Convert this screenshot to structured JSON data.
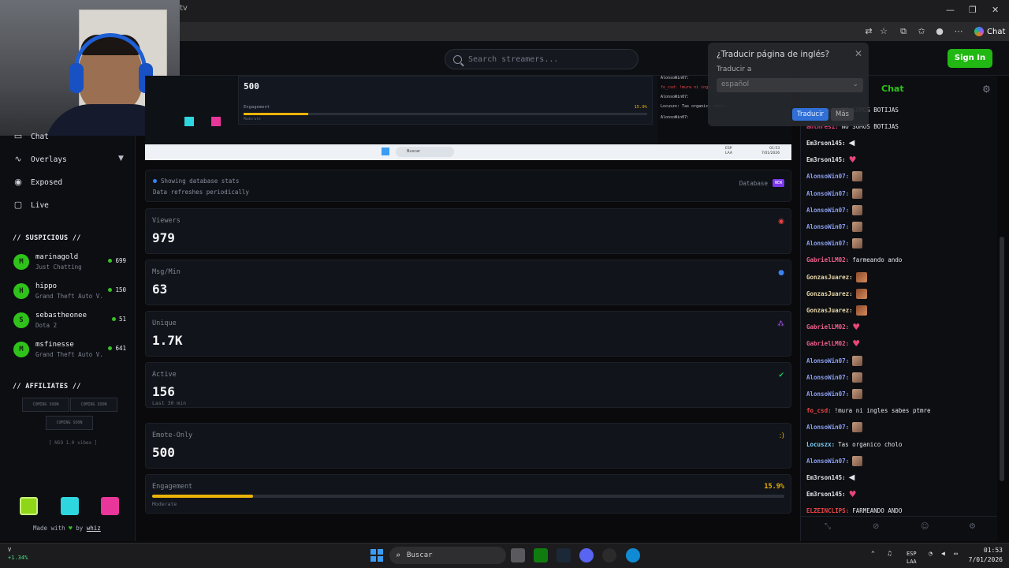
{
  "browser": {
    "address_fragment": "tv",
    "chat_button": "Chat",
    "window_controls": [
      "—",
      "❐",
      "✕"
    ]
  },
  "header": {
    "search_placeholder": "Search streamers...",
    "signin_label": "Sign In"
  },
  "translate_popup": {
    "title": "¿Traducir página de inglés?",
    "translate_to_label": "Traducir a",
    "language_value": "español",
    "translate_button": "Traducir",
    "more_button": "Más"
  },
  "sidebar": {
    "nav": [
      {
        "label": "Chat",
        "icon": "chat-icon"
      },
      {
        "label": "Overlays",
        "icon": "activity-icon"
      },
      {
        "label": "Exposed",
        "icon": "eye-icon"
      },
      {
        "label": "Live",
        "icon": "tv-icon"
      }
    ],
    "suspicious_header": "// SUSPICIOUS //",
    "suspicious": [
      {
        "initial": "M",
        "name": "marinagold",
        "game": "Just Chatting",
        "count": "699"
      },
      {
        "initial": "H",
        "name": "hippo",
        "game": "Grand Theft Auto V...",
        "count": "150"
      },
      {
        "initial": "S",
        "name": "sebastheonee",
        "game": "Dota 2",
        "count": "51"
      },
      {
        "initial": "M",
        "name": "msfinesse",
        "game": "Grand Theft Auto V...",
        "count": "641"
      }
    ],
    "affiliates_header": "// AFFILIATES //",
    "affiliates": [
      "COMING SOON",
      "COMING SOON",
      "COMING SOON"
    ],
    "affiliates_sub": "[ NSO 1.0 vibes ]",
    "swatch_colors": [
      "#8fd619",
      "#2ed6e0",
      "#e8369a"
    ],
    "made_with": "Made with",
    "by": "by",
    "author": "whiz"
  },
  "mini": {
    "stat_value": "500",
    "engagement_label": "Engagement",
    "engagement_pct": "15.9%",
    "engagement_sub": "Moderate",
    "chat_lines": [
      "AlonsoWin07:",
      "fo_csd: !mura ni ingles sabes ptmre",
      "AlonsoWin07:",
      "Locuszx: Tas organico cholo",
      "AlonsoWin07:"
    ]
  },
  "info": {
    "line1": "Showing database stats",
    "line2": "Data refreshes periodically",
    "database_label": "Database",
    "new_badge": "NEW"
  },
  "stats": [
    {
      "label": "Viewers",
      "value": "979",
      "sub": "",
      "icon": "eye-icon",
      "color": "#ef4444"
    },
    {
      "label": "Msg/Min",
      "value": "63",
      "sub": "",
      "icon": "message-icon",
      "color": "#3b82f6"
    },
    {
      "label": "Unique",
      "value": "1.7K",
      "sub": "",
      "icon": "users-icon",
      "color": "#a855f7"
    },
    {
      "label": "Active",
      "value": "156",
      "sub": "Last 30 min",
      "icon": "check-circle-icon",
      "color": "#22c55e"
    },
    {
      "label": "Emote-Only",
      "value": "500",
      "sub": "",
      "icon": "smile-icon",
      "color": "#eab308"
    }
  ],
  "engagement": {
    "label": "Engagement",
    "pct_text": "15.9%",
    "fraction": 0.159,
    "sub": "Moderate"
  },
  "chat": {
    "title": "Chat",
    "messages": [
      {
        "user": "anthres1:",
        "color": "#e8467a",
        "text": "NO SOMOS BOTIJAS",
        "emote": ""
      },
      {
        "user": "anthres1:",
        "color": "#e8467a",
        "text": "NO SOMOS BOTIJAS",
        "emote": ""
      },
      {
        "user": "Em3rson145:",
        "color": "#e4e7ec",
        "text": "",
        "emote": "spk"
      },
      {
        "user": "Em3rson145:",
        "color": "#e4e7ec",
        "text": "",
        "emote": "heart"
      },
      {
        "user": "AlonsoWin07:",
        "color": "#8da0f0",
        "text": "",
        "emote": "face"
      },
      {
        "user": "AlonsoWin07:",
        "color": "#8da0f0",
        "text": "",
        "emote": "face"
      },
      {
        "user": "AlonsoWin07:",
        "color": "#8da0f0",
        "text": "",
        "emote": "face"
      },
      {
        "user": "AlonsoWin07:",
        "color": "#8da0f0",
        "text": "",
        "emote": "face"
      },
      {
        "user": "AlonsoWin07:",
        "color": "#8da0f0",
        "text": "",
        "emote": "face"
      },
      {
        "user": "GabrielLM02:",
        "color": "#f0608c",
        "text": "farmeando ando",
        "emote": ""
      },
      {
        "user": "GonzasJuarez:",
        "color": "#e8d7a8",
        "text": "",
        "emote": "crowd"
      },
      {
        "user": "GonzasJuarez:",
        "color": "#e8d7a8",
        "text": "",
        "emote": "crowd"
      },
      {
        "user": "GonzasJuarez:",
        "color": "#e8d7a8",
        "text": "",
        "emote": "crowd"
      },
      {
        "user": "GabrielLM02:",
        "color": "#f0608c",
        "text": "",
        "emote": "heart"
      },
      {
        "user": "GabrielLM02:",
        "color": "#f0608c",
        "text": "",
        "emote": "heart"
      },
      {
        "user": "AlonsoWin07:",
        "color": "#8da0f0",
        "text": "",
        "emote": "face"
      },
      {
        "user": "AlonsoWin07:",
        "color": "#8da0f0",
        "text": "",
        "emote": "face"
      },
      {
        "user": "AlonsoWin07:",
        "color": "#8da0f0",
        "text": "",
        "emote": "face"
      },
      {
        "user": "fo_csd:",
        "color": "#ef4444",
        "text": "!mura ni ingles sabes ptmre",
        "emote": ""
      },
      {
        "user": "AlonsoWin07:",
        "color": "#8da0f0",
        "text": "",
        "emote": "face"
      },
      {
        "user": "Locuszx:",
        "color": "#7dd3fc",
        "text": "Tas organico cholo",
        "emote": ""
      },
      {
        "user": "AlonsoWin07:",
        "color": "#8da0f0",
        "text": "",
        "emote": "face"
      },
      {
        "user": "Em3rson145:",
        "color": "#e4e7ec",
        "text": "",
        "emote": "spk"
      },
      {
        "user": "Em3rson145:",
        "color": "#e4e7ec",
        "text": "",
        "emote": "heart"
      },
      {
        "user": "ELZEINCLIPS:",
        "color": "#ef4444",
        "text": "FARMEANDO ANDO",
        "emote": ""
      }
    ]
  },
  "taskbar": {
    "stock_name": "V",
    "stock_pct": "+1.34%",
    "search_label": "Buscar",
    "lang_top": "ESP",
    "lang_bottom": "LAA",
    "time": "01:53",
    "date": "7/01/2026"
  }
}
